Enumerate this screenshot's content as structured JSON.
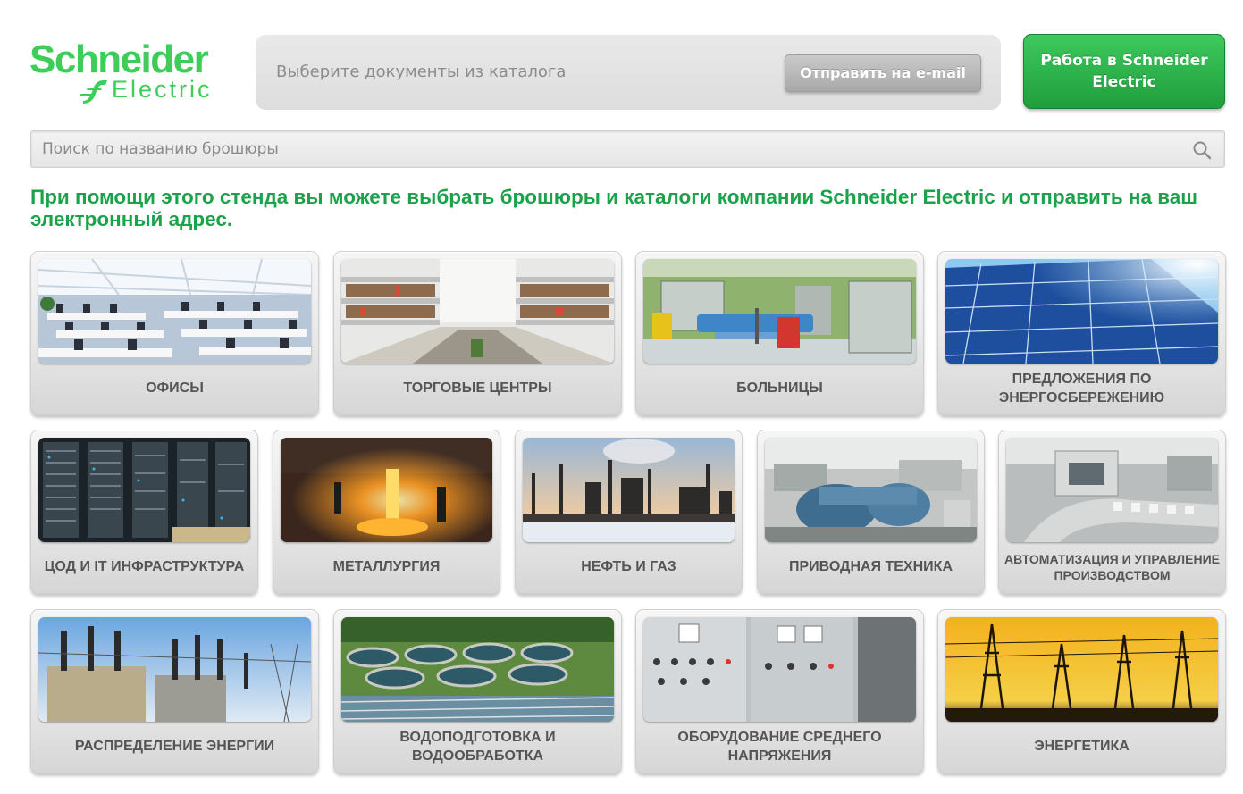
{
  "header": {
    "logo_brand": "Schneider",
    "logo_sub": "Electric",
    "catalog_hint": "Выберите документы из каталога",
    "send_email_label": "Отправить на e-mail",
    "job_button_label": "Работа в Schneider Electric"
  },
  "search": {
    "placeholder": "Поиск по названию брошюры"
  },
  "intro_text": "При помощи этого стенда вы можете выбрать брошюры и каталоги компании Schneider Electric и отправить на ваш электронный адрес.",
  "colors": {
    "brand_green": "#3dcd58",
    "intro_green": "#1aa34a",
    "button_green": "#1f9e3c",
    "tile_label": "#555555"
  },
  "categories": {
    "row1": [
      {
        "label": "Офисы",
        "icon": "office-photo"
      },
      {
        "label": "Торговые центры",
        "icon": "mall-photo"
      },
      {
        "label": "Больницы",
        "icon": "hospital-photo"
      },
      {
        "label": "Предложения по энергосбережению",
        "icon": "solar-panel-photo"
      }
    ],
    "row2": [
      {
        "label": "ЦОД и IT инфраструктура",
        "icon": "server-rack-photo"
      },
      {
        "label": "Металлургия",
        "icon": "molten-metal-photo"
      },
      {
        "label": "Нефть и газ",
        "icon": "refinery-photo"
      },
      {
        "label": "Приводная техника",
        "icon": "motor-photo"
      },
      {
        "label": "Автоматизация и управление производством",
        "icon": "production-line-photo"
      }
    ],
    "row3": [
      {
        "label": "Распределение энергии",
        "icon": "substation-photo"
      },
      {
        "label": "Водоподготовка и водообработка",
        "icon": "water-treatment-photo"
      },
      {
        "label": "Оборудование среднего напряжения",
        "icon": "switchgear-photo"
      },
      {
        "label": "Энергетика",
        "icon": "power-lines-photo"
      }
    ]
  }
}
